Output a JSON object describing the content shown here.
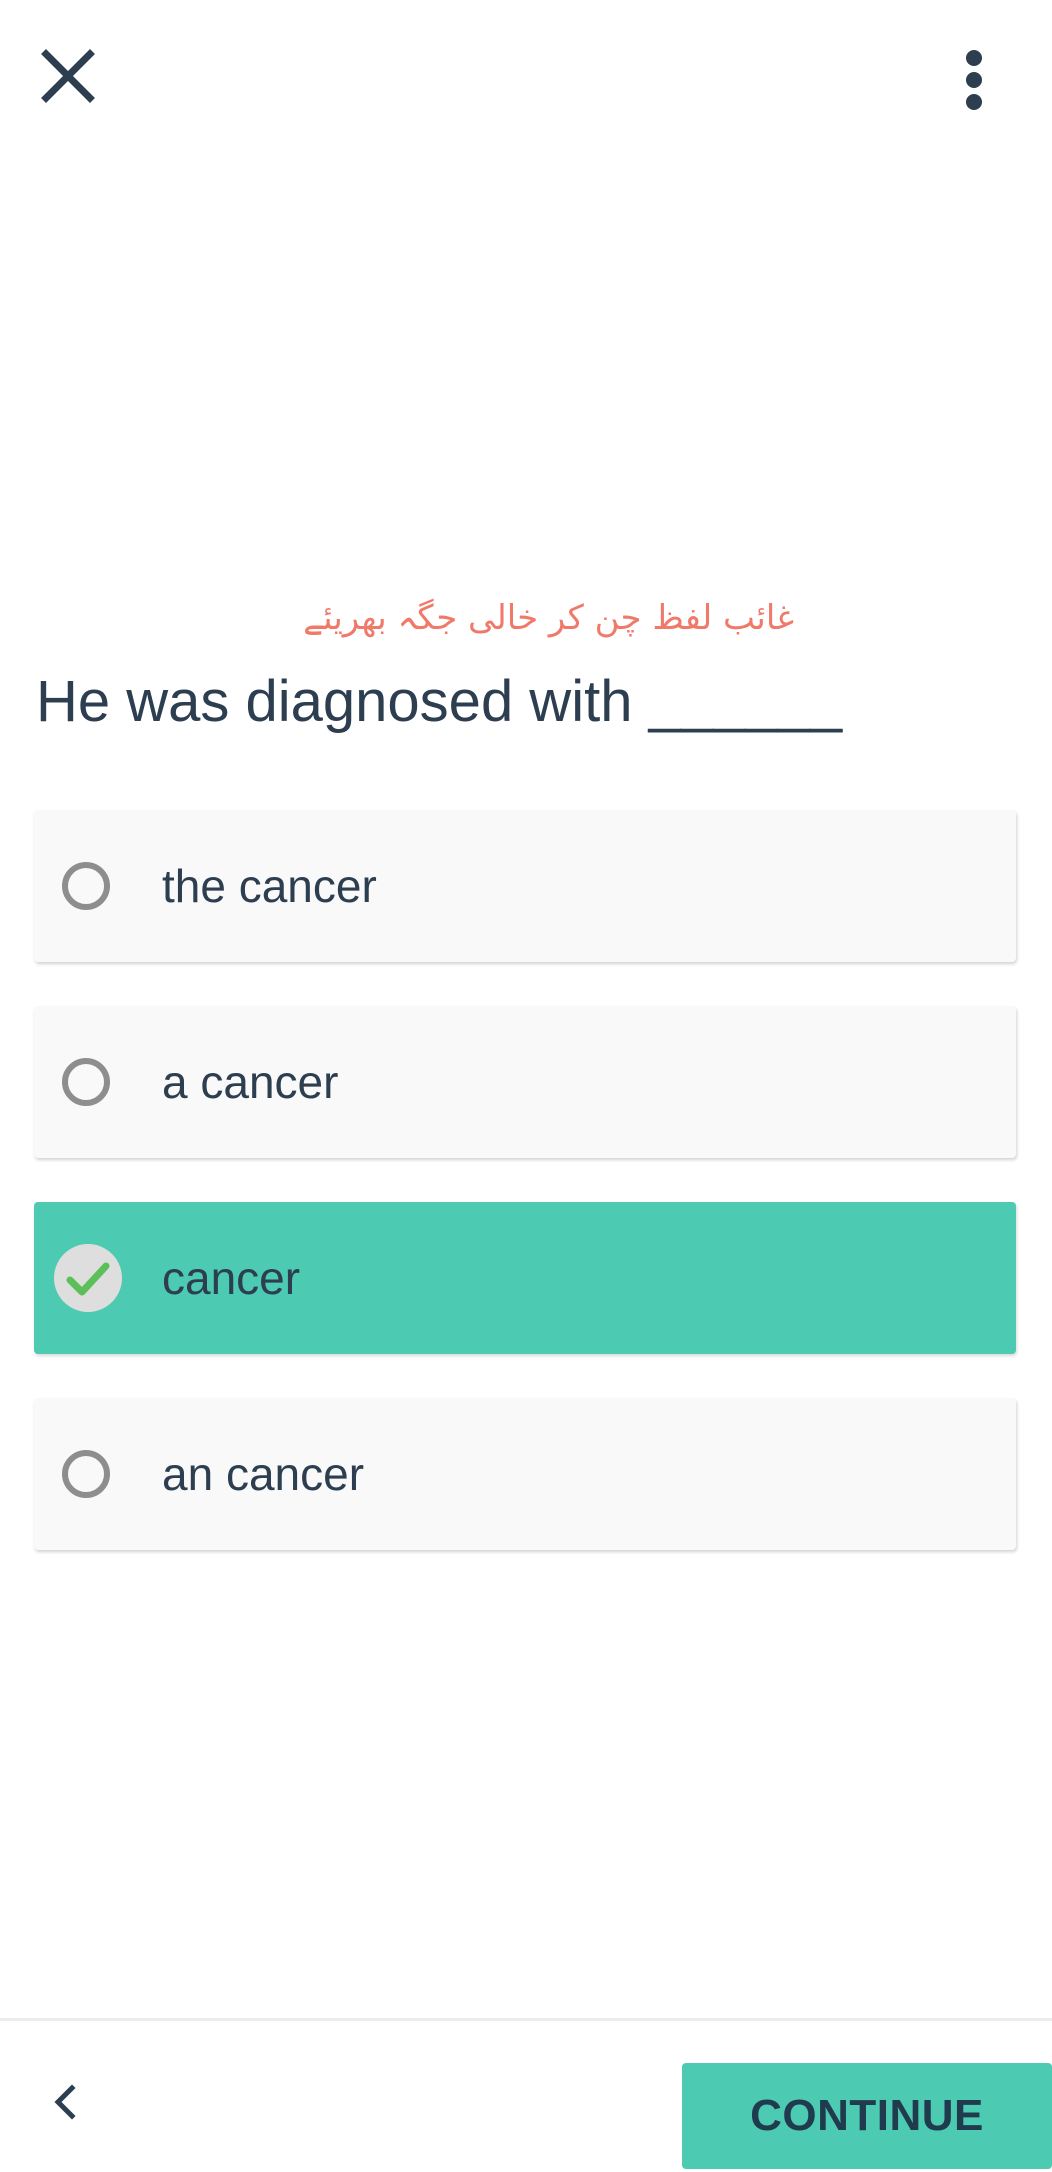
{
  "header": {
    "close_icon": "close-icon",
    "menu_icon": "more-vertical-icon"
  },
  "question": {
    "instruction": "غائب لفظ چن کر خالی جگہ بھریئے",
    "prompt": "He was diagnosed with ______"
  },
  "options": [
    {
      "label": "the cancer",
      "selected": false
    },
    {
      "label": "a cancer",
      "selected": false
    },
    {
      "label": "cancer",
      "selected": true
    },
    {
      "label": "an cancer",
      "selected": false
    }
  ],
  "footer": {
    "back_icon": "chevron-left-icon",
    "continue_label": "CONTINUE"
  },
  "colors": {
    "accent": "#4ccab2",
    "instruction_text": "#f07a6a",
    "primary_text": "#2c3e50",
    "radio_unselected": "#8e8e8e",
    "check": "#5cc05a"
  }
}
